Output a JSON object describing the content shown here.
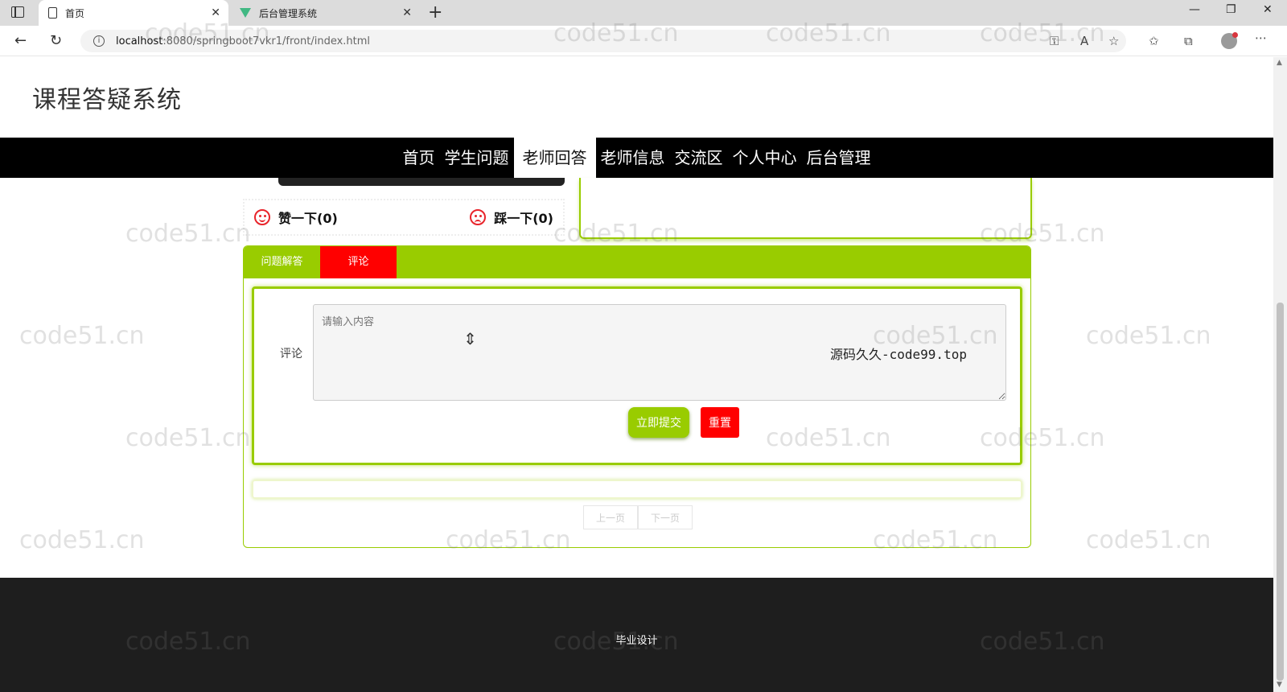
{
  "browser": {
    "tabs": [
      {
        "title": "首页",
        "icon": "document-icon",
        "active": true
      },
      {
        "title": "后台管理系统",
        "icon": "vue-logo-icon",
        "active": false
      }
    ],
    "new_tab_symbol": "+",
    "close_symbol": "✕",
    "window_controls": {
      "minimize": "—",
      "restore": "❐",
      "close": "✕"
    },
    "url_host": "localhost",
    "url_rest": ":8080/springboot7vkr1/front/index.html",
    "back_symbol": "←",
    "reload_symbol": "↻",
    "toolbar_icons": [
      "key-icon",
      "read-aloud-icon",
      "add-favorite-icon",
      "favorites-icon",
      "collections-icon",
      "profile-icon",
      "more-icon"
    ]
  },
  "site": {
    "title": "课程答疑系统",
    "nav": [
      "首页",
      "学生问题",
      "老师回答",
      "老师信息",
      "交流区",
      "个人中心",
      "后台管理"
    ],
    "active_nav": "老师回答"
  },
  "votes": {
    "like": "赞一下(0)",
    "dislike": "踩一下(0)"
  },
  "detail": {
    "tabs": [
      "问题解答",
      "评论"
    ],
    "form": {
      "label": "评论",
      "placeholder": "请输入内容",
      "submit": "立即提交",
      "reset": "重置"
    },
    "overlay_text": "源码久久-code99.top",
    "pager": {
      "prev": "上一页",
      "next": "下一页"
    }
  },
  "footer": {
    "text": "毕业设计"
  },
  "watermark": "code51.cn",
  "colors": {
    "accent_green": "#99cc00",
    "accent_red": "#ff0000",
    "nav_bg": "#000000",
    "footer_bg": "#1e1e1e"
  }
}
